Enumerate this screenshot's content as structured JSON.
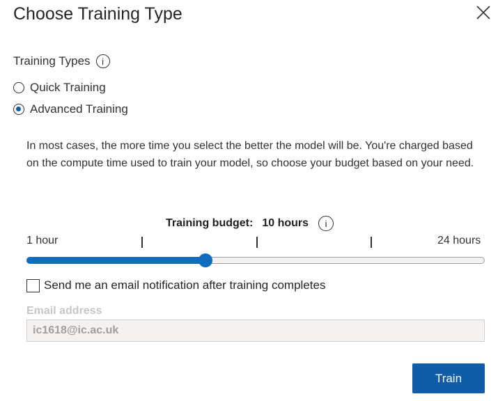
{
  "dialog": {
    "title": "Choose Training Type",
    "close_icon": "close-icon"
  },
  "training_types": {
    "label": "Training Types",
    "info_glyph": "i",
    "options": [
      {
        "label": "Quick Training",
        "selected": false
      },
      {
        "label": "Advanced Training",
        "selected": true
      }
    ]
  },
  "description": "In most cases, the more time you select the better the model will be. You're charged based on the compute time used to train your model, so choose your budget based on your need.",
  "budget": {
    "label": "Training budget:",
    "value_text": "10 hours",
    "info_glyph": "i",
    "min_label": "1 hour",
    "max_label": "24 hours",
    "min": 1,
    "max": 24,
    "value": 10
  },
  "notification": {
    "label": "Send me an email notification after training completes",
    "checked": false
  },
  "email": {
    "label": "Email address",
    "value": "ic1618@ic.ac.uk"
  },
  "actions": {
    "train_label": "Train"
  },
  "colors": {
    "accent": "#0f6cbd",
    "button": "#0f5ca8"
  }
}
